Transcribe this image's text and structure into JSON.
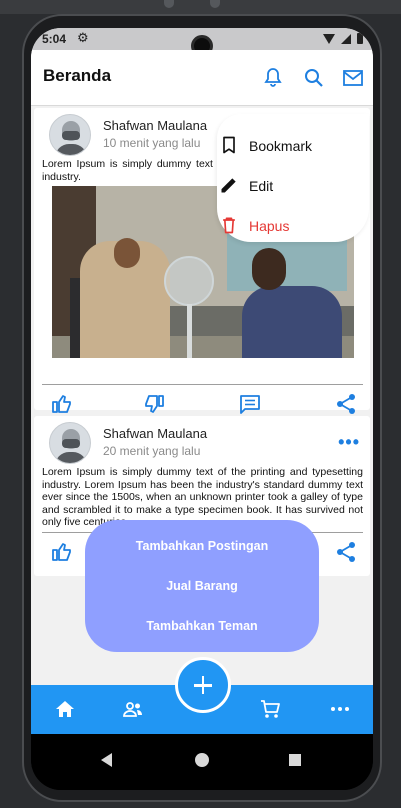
{
  "status_bar": {
    "time": "5:04"
  },
  "app_bar": {
    "title": "Beranda"
  },
  "posts": [
    {
      "author": "Shafwan Maulana",
      "time_ago": "10 menit yang lalu",
      "text": "Lorem Ipsum is simply dummy text of the printing and typesetting industry.",
      "has_image": true
    },
    {
      "author": "Shafwan Maulana",
      "time_ago": "20 menit yang lalu",
      "text": "Lorem Ipsum is simply dummy text of the printing and typesetting industry. Lorem Ipsum has been the industry's standard dummy text ever since the 1500s, when an unknown printer took a galley of type and scrambled it to make a type specimen book. It has survived not only five centuries,",
      "has_image": false
    }
  ],
  "post_menu": {
    "bookmark": "Bookmark",
    "edit": "Edit",
    "delete": "Hapus"
  },
  "fab_menu": {
    "add_post": "Tambahkan Postingan",
    "sell_item": "Jual Barang",
    "add_friend": "Tambahkan Teman"
  },
  "colors": {
    "primary": "#2196f3",
    "fab_menu_bg": "#8f9fff",
    "danger": "#e53935",
    "action_icon": "#1e7fe0"
  },
  "icons": {
    "app_bar": [
      "bell-icon",
      "search-icon",
      "mail-icon"
    ],
    "post_actions": [
      "thumb-up-icon",
      "thumb-down-icon",
      "comment-icon",
      "share-icon"
    ],
    "bottom_nav": [
      "home-icon",
      "friends-icon",
      "add-icon",
      "cart-icon",
      "more-icon"
    ]
  }
}
